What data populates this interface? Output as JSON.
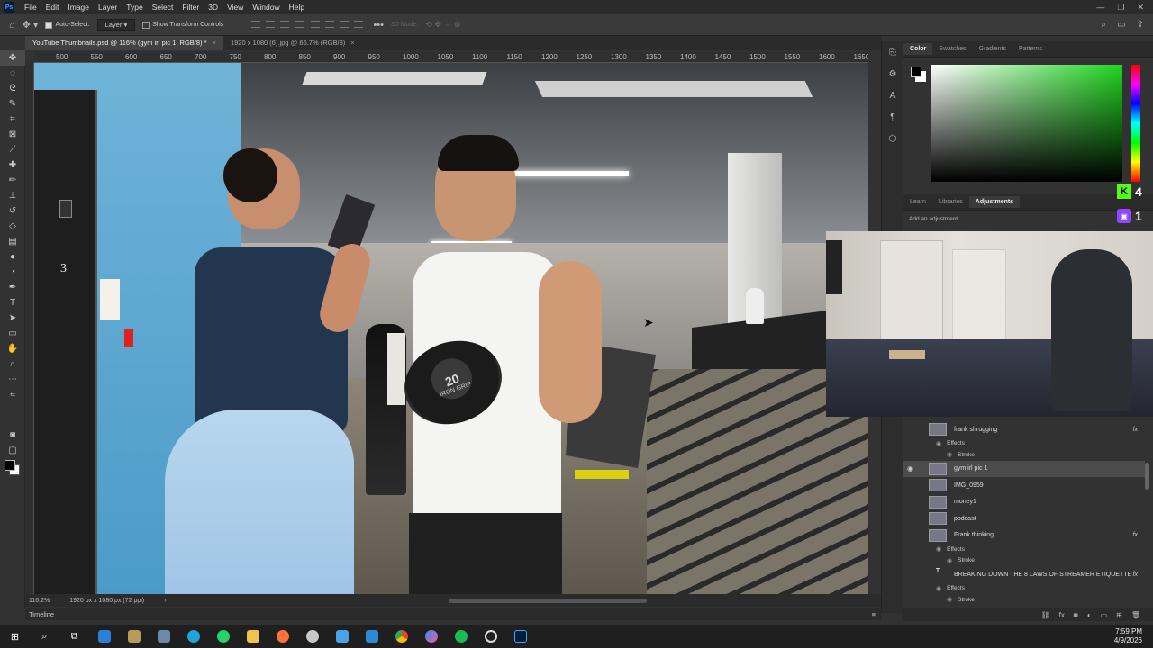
{
  "menubar": {
    "app_badge": "Ps",
    "items": [
      "File",
      "Edit",
      "Image",
      "Layer",
      "Type",
      "Select",
      "Filter",
      "3D",
      "View",
      "Window",
      "Help"
    ],
    "window_controls": [
      "—",
      "❐",
      "✕"
    ]
  },
  "options": {
    "auto_select_label": "Auto-Select:",
    "auto_select_checked": true,
    "target_value": "Layer",
    "transform_label": "Show Transform Controls",
    "mode_3d": "3D Mode:"
  },
  "tabs": [
    {
      "label": "YouTube Thumbnails.psd @ 116% (gym irl pic 1, RGB/8) *",
      "active": true
    },
    {
      "label": "1920 x 1080 (6).jpg @ 66.7% (RGB/8)",
      "active": false
    }
  ],
  "ruler": {
    "ticks": [
      "500",
      "550",
      "600",
      "650",
      "700",
      "750",
      "800",
      "850",
      "900",
      "950",
      "1000",
      "1050",
      "1100",
      "1150",
      "1200",
      "1250",
      "1300",
      "1350",
      "1400",
      "1450",
      "1500",
      "1550",
      "1600",
      "1650"
    ]
  },
  "canvas": {
    "floor_number": "3",
    "dumbbell_weight": "20",
    "dumbbell_brand": "IRON GRIP"
  },
  "status": {
    "zoom": "116.2%",
    "doc_size": "1920 px x 1080 px (72 ppi)"
  },
  "timeline_label": "Timeline",
  "color_panel": {
    "tabs": [
      "Color",
      "Swatches",
      "Gradients",
      "Patterns"
    ],
    "active_tab": "Color",
    "hue_color": "#1fd41f"
  },
  "adjustments_panel": {
    "tabs": [
      "Learn",
      "Libraries",
      "Adjustments"
    ],
    "active_tab": "Adjustments",
    "hint": "Add an adjustment"
  },
  "stream": {
    "kick_count": "4",
    "twitch_count": "1"
  },
  "layers": [
    {
      "name": "frank shrugging",
      "effects": true,
      "visible": false,
      "selected": false
    },
    {
      "name": "gym irl pic 1",
      "effects": false,
      "visible": true,
      "selected": true
    },
    {
      "name": "IMG_0959",
      "effects": false,
      "visible": false,
      "selected": false
    },
    {
      "name": "money1",
      "effects": false,
      "visible": false,
      "selected": false
    },
    {
      "name": "podcast",
      "effects": false,
      "visible": false,
      "selected": false
    },
    {
      "name": "Frank thinking",
      "effects": true,
      "visible": false,
      "selected": false
    },
    {
      "name": "BREAKING DOWN  THE 8 LAWS OF STREAMER ETIQUETTE",
      "effects": true,
      "visible": false,
      "selected": false,
      "type": "text"
    }
  ],
  "layer_labels": {
    "effects": "Effects",
    "stroke": "Stroke",
    "fx": "fx"
  },
  "taskbar": {
    "time": "7:59 PM",
    "date": "4/9/2026"
  }
}
